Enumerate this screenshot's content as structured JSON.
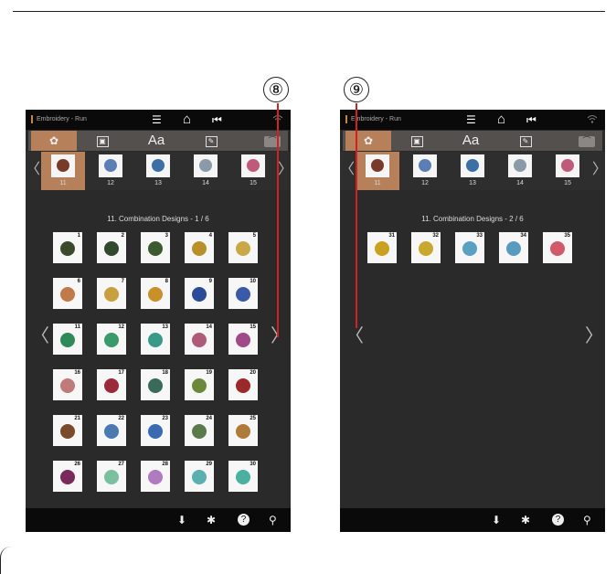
{
  "callouts": {
    "left": "⑧",
    "right": "⑨"
  },
  "screens": [
    {
      "status_title": "Embroidery - Run",
      "icons": {
        "menu": "☰",
        "home": "⌂",
        "back": "⏮",
        "wifi": "wifi-icon"
      },
      "tabs": {
        "builtin": "✿",
        "frame": "▣",
        "text": "Aa",
        "edit": "✎",
        "minimize": "⌒"
      },
      "categories": [
        {
          "num": "11",
          "color": "#7a3a2a"
        },
        {
          "num": "12",
          "color": "#5b7fb5"
        },
        {
          "num": "13",
          "color": "#3b6fa5"
        },
        {
          "num": "14",
          "color": "#8a9aa8"
        },
        {
          "num": "15",
          "color": "#c05a7a"
        }
      ],
      "page_label": "11. Combination Designs - 1 / 6",
      "designs": [
        {
          "num": "1",
          "color": "#3a4a2a"
        },
        {
          "num": "2",
          "color": "#2f4a2a"
        },
        {
          "num": "3",
          "color": "#3c5a30"
        },
        {
          "num": "4",
          "color": "#b8902a"
        },
        {
          "num": "5",
          "color": "#c9a84a"
        },
        {
          "num": "6",
          "color": "#c07a4a"
        },
        {
          "num": "7",
          "color": "#c9a040"
        },
        {
          "num": "8",
          "color": "#c9902a"
        },
        {
          "num": "9",
          "color": "#2a4a9a"
        },
        {
          "num": "10",
          "color": "#3a5aa8"
        },
        {
          "num": "11",
          "color": "#2f8a5a"
        },
        {
          "num": "12",
          "color": "#3a9a6a"
        },
        {
          "num": "13",
          "color": "#3a9a8a"
        },
        {
          "num": "14",
          "color": "#b05a7a"
        },
        {
          "num": "15",
          "color": "#a04a8a"
        },
        {
          "num": "16",
          "color": "#c07a7a"
        },
        {
          "num": "17",
          "color": "#9a2a3a"
        },
        {
          "num": "18",
          "color": "#3a6a5a"
        },
        {
          "num": "19",
          "color": "#6a8a3a"
        },
        {
          "num": "20",
          "color": "#9a2a2a"
        },
        {
          "num": "21",
          "color": "#7a4a2a"
        },
        {
          "num": "22",
          "color": "#4a7ab0"
        },
        {
          "num": "23",
          "color": "#3a6ab0"
        },
        {
          "num": "24",
          "color": "#5a7a4a"
        },
        {
          "num": "25",
          "color": "#b07a3a"
        },
        {
          "num": "26",
          "color": "#7a2a5a"
        },
        {
          "num": "27",
          "color": "#7ac0a0"
        },
        {
          "num": "28",
          "color": "#b07ac0"
        },
        {
          "num": "29",
          "color": "#5ab0b0"
        },
        {
          "num": "30",
          "color": "#4ab0a0"
        }
      ]
    },
    {
      "status_title": "Embroidery - Run",
      "icons": {
        "menu": "☰",
        "home": "⌂",
        "back": "⏮",
        "wifi": "wifi-icon"
      },
      "tabs": {
        "builtin": "✿",
        "frame": "▣",
        "text": "Aa",
        "edit": "✎",
        "minimize": "⌒"
      },
      "categories": [
        {
          "num": "11",
          "color": "#7a3a2a"
        },
        {
          "num": "12",
          "color": "#5b7fb5"
        },
        {
          "num": "13",
          "color": "#3b6fa5"
        },
        {
          "num": "14",
          "color": "#8a9aa8"
        },
        {
          "num": "15",
          "color": "#c05a7a"
        }
      ],
      "page_label": "11. Combination Designs - 2 / 6",
      "designs": [
        {
          "num": "31",
          "color": "#c9a020"
        },
        {
          "num": "32",
          "color": "#c9a830"
        },
        {
          "num": "33",
          "color": "#5aa0c0"
        },
        {
          "num": "34",
          "color": "#5a9ac0"
        },
        {
          "num": "35",
          "color": "#d05a6a"
        }
      ]
    }
  ],
  "nav": {
    "prev": "〈",
    "next": "〉"
  },
  "bottom_icons": {
    "save": "⬇",
    "settings": "✱",
    "help": "?",
    "tools": "⚲"
  }
}
